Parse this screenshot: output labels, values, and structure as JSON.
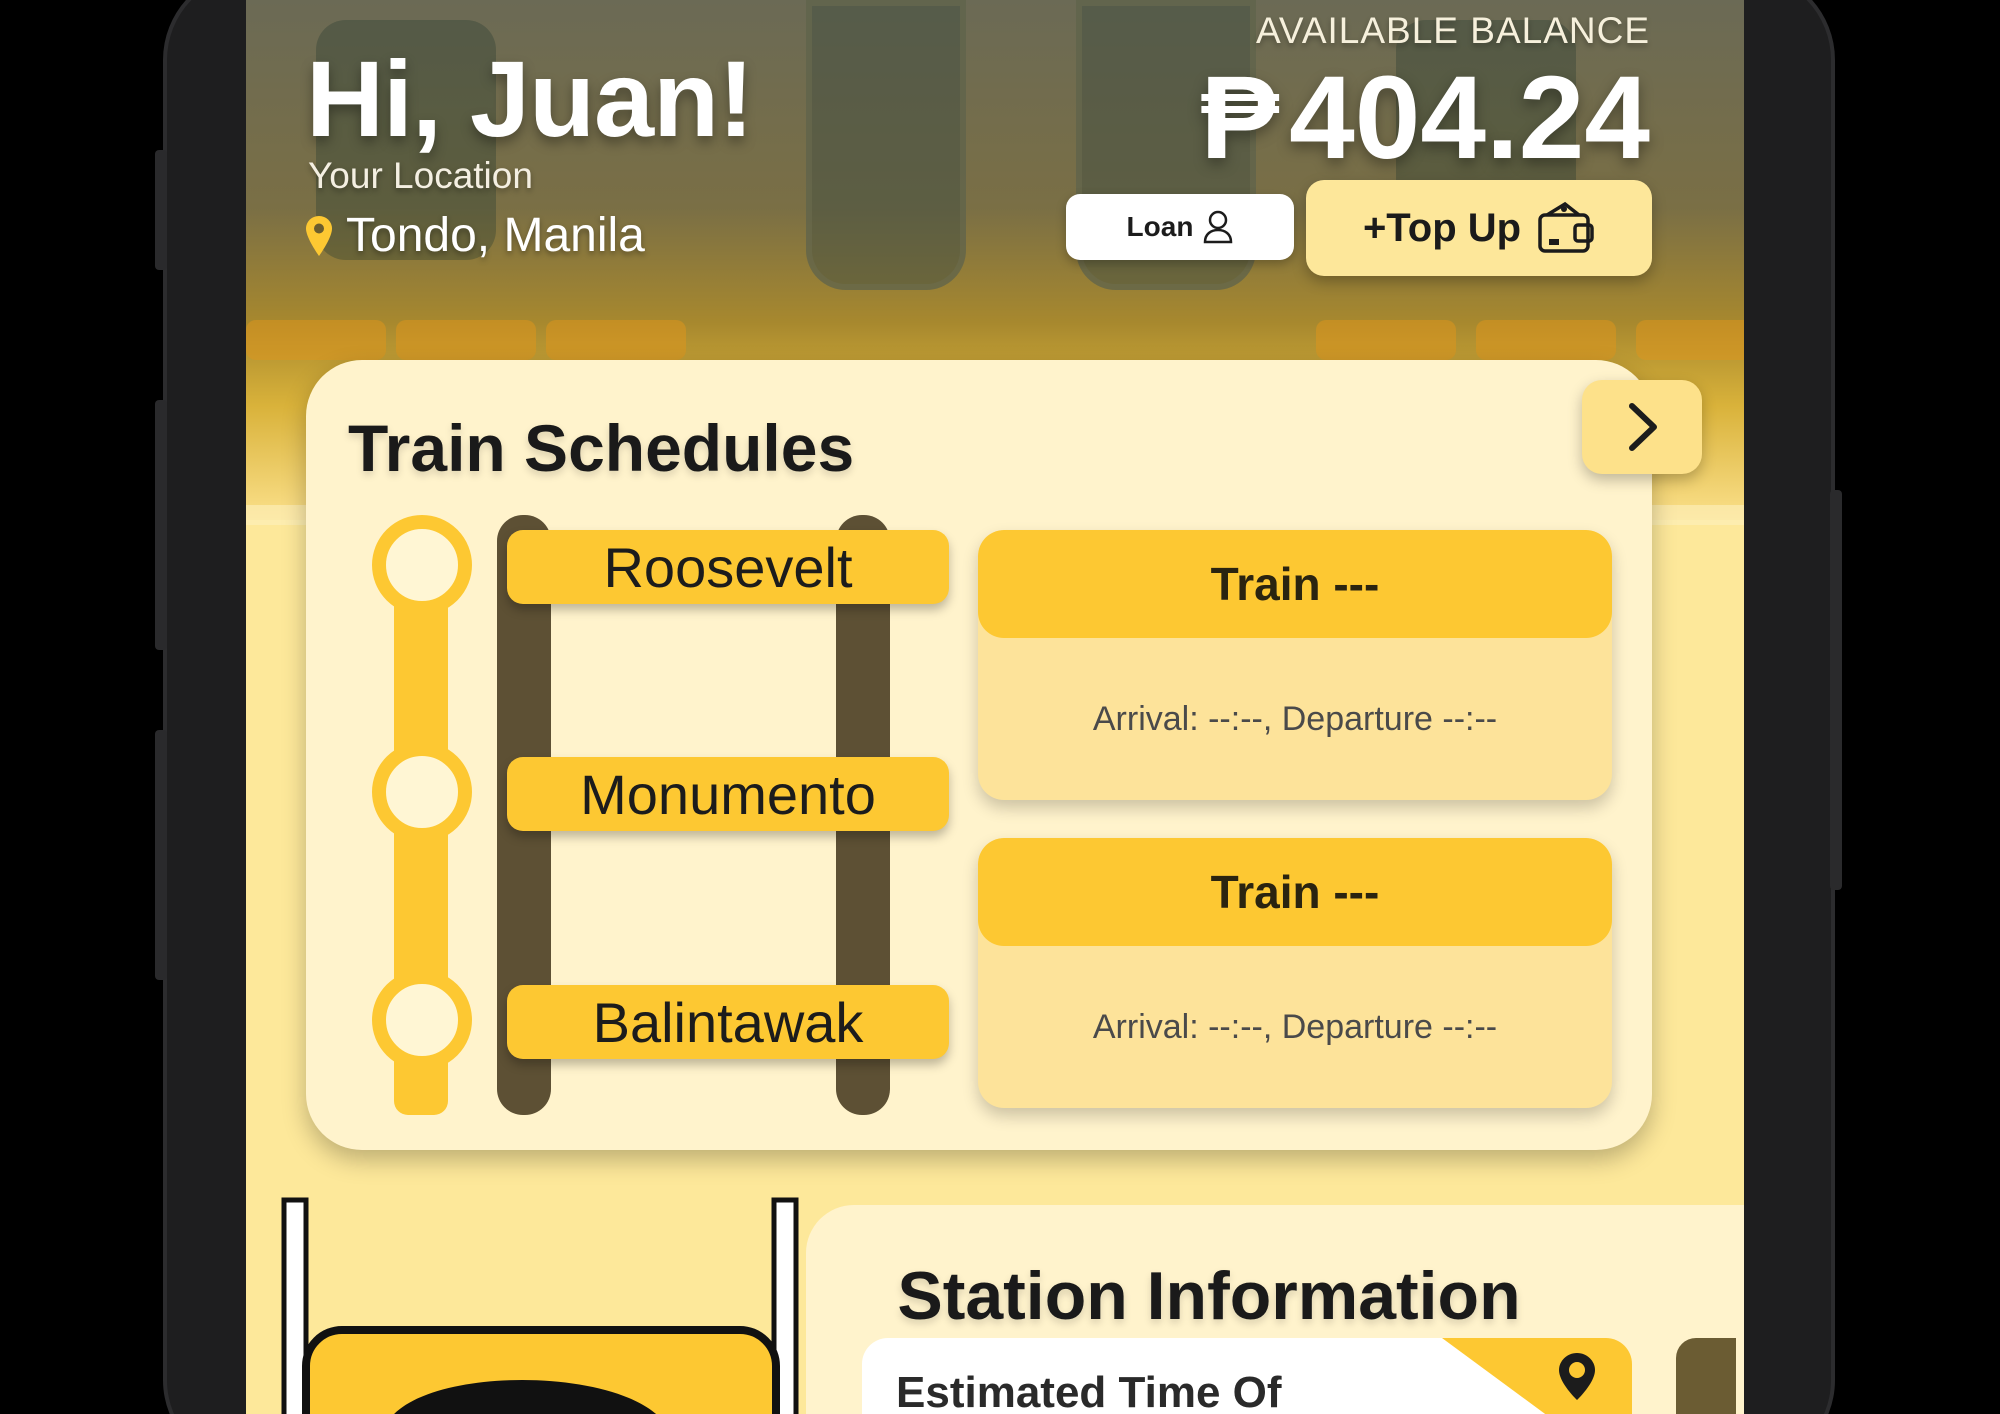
{
  "header": {
    "greeting": "Hi, Juan!",
    "location_label": "Your Location",
    "location": "Tondo, Manila",
    "pin_icon": "location-pin-icon"
  },
  "balance": {
    "label": "AVAILABLE BALANCE",
    "currency": "₱",
    "amount": "404.24"
  },
  "actions": {
    "loan_label": "Loan",
    "loan_icon": "user-icon",
    "topup_label": "+Top Up",
    "topup_icon": "wallet-icon"
  },
  "schedules": {
    "title": "Train Schedules",
    "next_icon": "chevron-right-icon",
    "stations": [
      {
        "name": "Roosevelt"
      },
      {
        "name": "Monumento"
      },
      {
        "name": "Balintawak"
      }
    ],
    "trains": [
      {
        "title": "Train ---",
        "times": "Arrival: --:--, Departure --:--"
      },
      {
        "title": "Train ---",
        "times": "Arrival: --:--, Departure --:--"
      }
    ]
  },
  "station_info": {
    "title": "Station Information",
    "eta_label": "Estimated Time Of"
  },
  "colors": {
    "accent": "#fdc832",
    "card": "#fff3cc",
    "rail": "#5d5034"
  }
}
